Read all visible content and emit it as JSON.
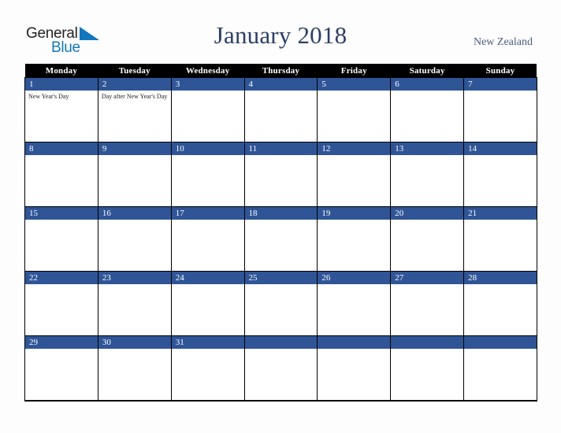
{
  "brand": {
    "logo_word_1": "General",
    "logo_word_2": "Blue",
    "logo_mark_icon": "triangle-swoosh-icon",
    "accent_blue": "#1277bd",
    "dark_text": "#231f20"
  },
  "header": {
    "title": "January 2018",
    "country": "New Zealand",
    "title_color": "#2c3e66",
    "country_color": "#4a5b80"
  },
  "calendar": {
    "month": "January",
    "year": "2018",
    "week_start": "Monday",
    "header_bg": "#000000",
    "date_bar_bg": "#2f5597",
    "grid_color": "#000000",
    "weekdays": [
      "Monday",
      "Tuesday",
      "Wednesday",
      "Thursday",
      "Friday",
      "Saturday",
      "Sunday"
    ],
    "weeks": [
      {
        "days": [
          {
            "number": "1",
            "event": "New Year's Day"
          },
          {
            "number": "2",
            "event": "Day after New Year's Day"
          },
          {
            "number": "3",
            "event": ""
          },
          {
            "number": "4",
            "event": ""
          },
          {
            "number": "5",
            "event": ""
          },
          {
            "number": "6",
            "event": ""
          },
          {
            "number": "7",
            "event": ""
          }
        ]
      },
      {
        "days": [
          {
            "number": "8",
            "event": ""
          },
          {
            "number": "9",
            "event": ""
          },
          {
            "number": "10",
            "event": ""
          },
          {
            "number": "11",
            "event": ""
          },
          {
            "number": "12",
            "event": ""
          },
          {
            "number": "13",
            "event": ""
          },
          {
            "number": "14",
            "event": ""
          }
        ]
      },
      {
        "days": [
          {
            "number": "15",
            "event": ""
          },
          {
            "number": "16",
            "event": ""
          },
          {
            "number": "17",
            "event": ""
          },
          {
            "number": "18",
            "event": ""
          },
          {
            "number": "19",
            "event": ""
          },
          {
            "number": "20",
            "event": ""
          },
          {
            "number": "21",
            "event": ""
          }
        ]
      },
      {
        "days": [
          {
            "number": "22",
            "event": ""
          },
          {
            "number": "23",
            "event": ""
          },
          {
            "number": "24",
            "event": ""
          },
          {
            "number": "25",
            "event": ""
          },
          {
            "number": "26",
            "event": ""
          },
          {
            "number": "27",
            "event": ""
          },
          {
            "number": "28",
            "event": ""
          }
        ]
      },
      {
        "days": [
          {
            "number": "29",
            "event": ""
          },
          {
            "number": "30",
            "event": ""
          },
          {
            "number": "31",
            "event": ""
          },
          {
            "number": "",
            "event": ""
          },
          {
            "number": "",
            "event": ""
          },
          {
            "number": "",
            "event": ""
          },
          {
            "number": "",
            "event": ""
          }
        ]
      }
    ]
  }
}
